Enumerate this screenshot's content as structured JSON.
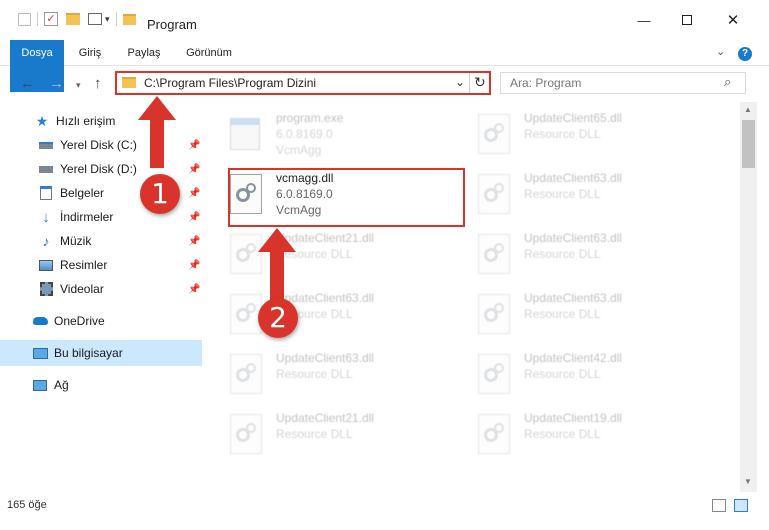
{
  "window": {
    "title": "Program"
  },
  "ribbon": {
    "tabs": [
      "Dosya",
      "Giriş",
      "Paylaş",
      "Görünüm"
    ],
    "help": "?"
  },
  "nav": {
    "address": "C:\\Program Files\\Program Dizini",
    "search_placeholder": "Ara: Program"
  },
  "sidebar": {
    "quick_access": "Hızlı erişim",
    "items": [
      {
        "label": "Yerel Disk (C:)",
        "icon": "drive-icon",
        "pinned": true
      },
      {
        "label": "Yerel Disk (D:)",
        "icon": "drive-icon",
        "pinned": true
      },
      {
        "label": "Belgeler",
        "icon": "documents-icon",
        "pinned": true
      },
      {
        "label": "İndirmeler",
        "icon": "download-icon",
        "pinned": true
      },
      {
        "label": "Müzik",
        "icon": "music-icon",
        "pinned": true
      },
      {
        "label": "Resimler",
        "icon": "pictures-icon",
        "pinned": true
      },
      {
        "label": "Videolar",
        "icon": "videos-icon",
        "pinned": true
      }
    ],
    "onedrive": "OneDrive",
    "this_pc": "Bu bilgisayar",
    "network": "Ağ"
  },
  "files": [
    {
      "name": "program.exe",
      "line2": "6.0.8169.0",
      "line3": "VcmAgg"
    },
    {
      "name": "UpdateClient65.dll",
      "line2": "Resource DLL",
      "line3": ""
    },
    {
      "name": "vcmagg.dll",
      "line2": "6.0.8169.0",
      "line3": "VcmAgg"
    },
    {
      "name": "UpdateClient63.dll",
      "line2": "Resource DLL",
      "line3": ""
    },
    {
      "name": "UpdateClient21.dll",
      "line2": "Resource DLL",
      "line3": ""
    },
    {
      "name": "UpdateClient63.dll",
      "line2": "Resource DLL",
      "line3": ""
    },
    {
      "name": "UpdateClient63.dll",
      "line2": "Resource DLL",
      "line3": ""
    },
    {
      "name": "UpdateClient63.dll",
      "line2": "Resource DLL",
      "line3": ""
    },
    {
      "name": "UpdateClient63.dll",
      "line2": "Resource DLL",
      "line3": ""
    },
    {
      "name": "UpdateClient42.dll",
      "line2": "Resource DLL",
      "line3": ""
    },
    {
      "name": "UpdateClient21.dll",
      "line2": "Resource DLL",
      "line3": ""
    },
    {
      "name": "UpdateClient19.dll",
      "line2": "Resource DLL",
      "line3": ""
    }
  ],
  "status": {
    "count": "165 öğe"
  },
  "annotations": {
    "step1": "1",
    "step2": "2",
    "color": "#d9342b"
  }
}
